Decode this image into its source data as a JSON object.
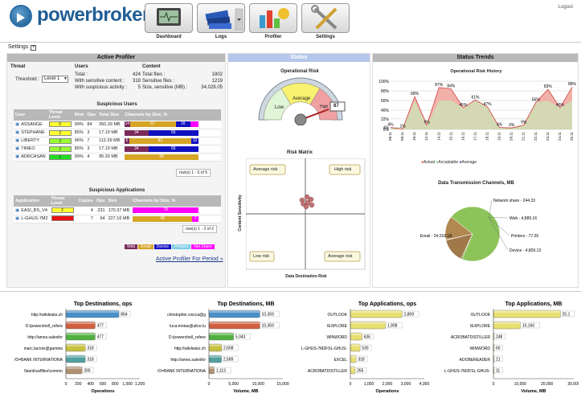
{
  "header": {
    "logo": "powerbroker",
    "logo_reg": "®",
    "logo_dlp": "dlp",
    "logout": "Logout",
    "nav": [
      {
        "label": "Dashboard"
      },
      {
        "label": "Logs"
      },
      {
        "label": "Profiler"
      },
      {
        "label": "Settings"
      }
    ]
  },
  "settings_label": "Settings",
  "settings_toggle": "+",
  "active_profiler": {
    "title": "Active Profiler",
    "headers": [
      "Threat",
      "Users",
      "Content"
    ],
    "threshold_label": "Threshold :",
    "threshold_value": "Level 1",
    "users_stats": [
      {
        "label": "Total :",
        "value": "424"
      },
      {
        "label": "With sensitive content :",
        "value": "318"
      },
      {
        "label": "With suspicious activity :",
        "value": "5"
      }
    ],
    "content_stats": [
      {
        "label": "Total files :",
        "value": "1802"
      },
      {
        "label": "Sensitive files :",
        "value": "1219"
      },
      {
        "label": "Size, sensitive (MB) :",
        "value": "34,029.05"
      }
    ],
    "users_title": "Suspicious Users",
    "users_columns": [
      "User",
      "Threat Level",
      "Risk",
      "Ops",
      "Total Size",
      "Channels by Size, %"
    ],
    "users": [
      {
        "name": "ASSANGE",
        "level": "5",
        "level_color": "#ffff33",
        "risk": "99%",
        "ops": "84",
        "size": "350.39 MB",
        "channels": [
          {
            "v": "14",
            "w": 0.07,
            "c": "#7a2a5a"
          },
          {
            "v": "67",
            "w": 0.62,
            "c": "#d6a526"
          },
          {
            "v": "16",
            "w": 0.2,
            "c": "#1010c0"
          },
          {
            "v": "",
            "w": 0.11,
            "c": "#ff00ff"
          }
        ]
      },
      {
        "name": "STEPHANE",
        "level": "2",
        "level_color": "#ffff33",
        "risk": "85%",
        "ops": "3",
        "size": "17.19 MB",
        "channels": [
          {
            "v": "34",
            "w": 0.32,
            "c": "#7a2a5a"
          },
          {
            "v": "65",
            "w": 0.68,
            "c": "#1010c0"
          }
        ]
      },
      {
        "name": "LIBERTY",
        "level": "2",
        "level_color": "#99ff33",
        "risk": "96%",
        "ops": "7",
        "size": "112.39 MB",
        "channels": [
          {
            "v": "6",
            "w": 0.06,
            "c": "#7a2a5a"
          },
          {
            "v": "83",
            "w": 0.84,
            "c": "#d6a526"
          },
          {
            "v": "10",
            "w": 0.1,
            "c": "#1010c0"
          }
        ]
      },
      {
        "name": "TIMEO",
        "level": "2",
        "level_color": "#99ff33",
        "risk": "85%",
        "ops": "3",
        "size": "17.19 MB",
        "channels": [
          {
            "v": "34",
            "w": 0.32,
            "c": "#7a2a5a"
          },
          {
            "v": "65",
            "w": 0.68,
            "c": "#1010c0"
          }
        ]
      },
      {
        "name": "ADRCASAN",
        "level": "1",
        "level_color": "#22dd22",
        "risk": "99%",
        "ops": "4",
        "size": "95.20 MB",
        "channels": [
          {
            "v": "99",
            "w": 1.0,
            "c": "#d6a526"
          }
        ]
      }
    ],
    "users_pager": "row(s) 1 - 5 of 5",
    "apps_title": "Suspicious Applications",
    "apps_columns": [
      "Application",
      "Threat Level",
      "Copies",
      "Ops",
      "Size",
      "Channels by Size, %"
    ],
    "apps": [
      {
        "name": "EASI_BS_V4",
        "level": "2",
        "level_color": "#ffff33",
        "copies": "4",
        "ops": "231",
        "size": "170.37 MB",
        "channels": [
          {
            "v": "79",
            "w": 1.0,
            "c": "#ff00ff"
          }
        ]
      },
      {
        "name": "L-GHUS-7M2",
        "level": "",
        "level_color": "#ee1111",
        "copies": "7",
        "ops": "64",
        "size": "227.16 MB",
        "channels": [
          {
            "v": "49",
            "w": 0.9,
            "c": "#d6a526"
          },
          {
            "v": "7",
            "w": 0.1,
            "c": "#ff00ff"
          }
        ]
      }
    ],
    "apps_pager": "row(s) 1 - 2 of 2",
    "legend": [
      {
        "label": "Web",
        "color": "#7a2a5a"
      },
      {
        "label": "Email",
        "color": "#d6a526"
      },
      {
        "label": "Device",
        "color": "#1010c0"
      },
      {
        "label": "Printers",
        "color": "#7ecbe6"
      },
      {
        "label": "Net.Share",
        "color": "#ff00ff"
      }
    ],
    "link": "Active Profiler For Period »"
  },
  "status": {
    "title": "Status",
    "risk_title": "Operational Risk",
    "gauge_low": "Low",
    "gauge_avg": "Average",
    "gauge_high": "High",
    "gauge_value": "87",
    "matrix_title": "Risk Matrix",
    "q_tl": "Average risk",
    "q_tr": "High risk",
    "q_bl": "Low risk",
    "q_br": "Average risk",
    "ylabel": "Content Sensitivity",
    "xlabel": "Data Destination Risk"
  },
  "trends": {
    "title": "Status Trends",
    "hist_title": "Operational Risk History",
    "legend": [
      {
        "label": "Actual",
        "color": "#e03030"
      },
      {
        "label": "Acceptable",
        "color": "#66cc66"
      },
      {
        "label": "Average",
        "color": "#2233aa"
      }
    ],
    "pie_title": "Data Transmission Channels, MB"
  },
  "chart_data": [
    {
      "type": "area",
      "title": "Operational Risk History",
      "yticks": [
        "100%",
        "80%",
        "60%",
        "40%",
        "22%",
        "4%",
        "0%"
      ],
      "x": [
        "08.11",
        "09.11",
        "10.11",
        "12.11",
        "14.11",
        "15.11",
        "16.11",
        "17.11",
        "18.11",
        "19.11",
        "20.11",
        "21.11",
        "22.11",
        "23.11",
        "24.11",
        "25.11"
      ],
      "series": [
        {
          "name": "Actual",
          "values": [
            4,
            1,
            68,
            9,
            87,
            84,
            45,
            61,
            47,
            4,
            3,
            9,
            56,
            83,
            45,
            88
          ]
        }
      ]
    },
    {
      "type": "pie",
      "title": "Data Transmission Channels, MB",
      "slices": [
        {
          "label": "Email - 24,018.18",
          "value": 24018.18,
          "color": "#8dc45a"
        },
        {
          "label": "Network share - 244.33",
          "value": 244.33,
          "color": "#6a9a40"
        },
        {
          "label": "Web - 4,889.16",
          "value": 4889.16,
          "color": "#a0784a"
        },
        {
          "label": "Printers - 77.26",
          "value": 77.26,
          "color": "#c8a070"
        },
        {
          "label": "Device - 4,809.13",
          "value": 4809.13,
          "color": "#b08850"
        }
      ]
    },
    {
      "type": "bar",
      "title": "Top Destinations, ops",
      "xlabel": "Operations",
      "xticks": [
        "0",
        "200",
        "400",
        "600",
        "800",
        "1,000",
        "1,200"
      ],
      "xmax": 1200,
      "categories": [
        "http://wikileaks.ch",
        "D:/powershell_refere",
        "http://ames.salesfor",
        "marc.lacroix@gamtes",
        "/O=BANK INTERNATIONA",
        "\\\\bank\\usffiles\\commo"
      ],
      "values": [
        864,
        477,
        477,
        318,
        318,
        265
      ],
      "labels": [
        "864",
        "477",
        "477",
        "318",
        "318",
        "265"
      ],
      "colors": [
        "#4a90c8",
        "#d06040",
        "#50b040",
        "#c8c040",
        "#50a0a0",
        "#b09070"
      ]
    },
    {
      "type": "bar",
      "title": "Top Destinations, MB",
      "xlabel": "Volume, MB",
      "xticks": [
        "0",
        "5,000",
        "10,000",
        "15,000"
      ],
      "xmax": 15000,
      "categories": [
        "christopher.ciocca@g",
        "luca.motas@alice.lu",
        "D:/powershell_refere",
        "http://wikileaks.ch",
        "http://ames.salesfor",
        "/O=BANK INTERNATIONA"
      ],
      "values": [
        10359,
        10359,
        5043,
        2608,
        2589,
        1113
      ],
      "labels": [
        "10,359",
        "10,359",
        "5,043",
        "2,608",
        "2,589",
        "1,113"
      ],
      "colors": [
        "#4a90c8",
        "#d06040",
        "#50b040",
        "#c8c040",
        "#50a0a0",
        "#b09070"
      ]
    },
    {
      "type": "bar",
      "title": "Top Applications, ops",
      "xlabel": "Operations",
      "xticks": [
        "0",
        "1,000",
        "2,000",
        "3,000",
        "4,000"
      ],
      "xmax": 4000,
      "categories": [
        "OUTLOOK",
        "IEXPLORE",
        "WINWORD",
        "L-GHUS-7M2FSL-GHUS-",
        "EXCEL",
        "ACROBATDISTILLER"
      ],
      "values": [
        2809,
        1908,
        636,
        530,
        318,
        265
      ],
      "labels": [
        "2,809",
        "1,908",
        "636",
        "530",
        "318",
        "265"
      ],
      "colors": [
        "#e8e070",
        "#e8e070",
        "#e8e070",
        "#e8e070",
        "#e8e070",
        "#e8e070"
      ]
    },
    {
      "type": "bar",
      "title": "Top Applications, MB",
      "xlabel": "Volume, MB",
      "xticks": [
        "0",
        "10,000",
        "20,000",
        "30,000"
      ],
      "xmax": 30000,
      "categories": [
        "OUTLOOK",
        "IEXPLORE",
        "ACROBATDISTILLER",
        "WINWORD",
        "ADOBEREADER",
        "L-GHUS-7M2FSL-GHUS-"
      ],
      "values": [
        25100,
        10160,
        248,
        60,
        21,
        11
      ],
      "labels": [
        "25,1",
        "10,160",
        "248",
        "60",
        "21",
        "11"
      ],
      "colors": [
        "#e8e070",
        "#e8e070",
        "#e8e070",
        "#e8e070",
        "#e8e070",
        "#e8e070"
      ]
    }
  ]
}
